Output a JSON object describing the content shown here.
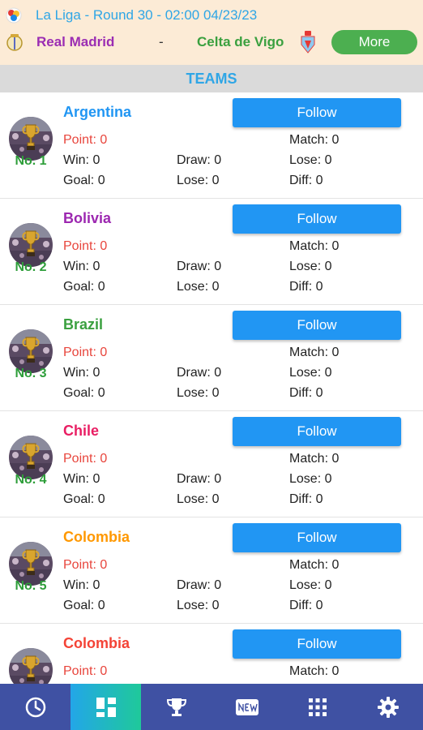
{
  "match": {
    "round_text": "La Liga - Round 30 - 02:00 04/23/23",
    "home_team": "Real Madrid",
    "separator": "-",
    "away_team": "Celta de Vigo",
    "more_label": "More"
  },
  "section_title": "TEAMS",
  "follow_label": "Follow",
  "teams": [
    {
      "name": "Argentina",
      "color": "#2196f3",
      "rank": "No. 1",
      "point": "Point: 0",
      "match": "Match: 0",
      "win": "Win: 0",
      "draw": "Draw: 0",
      "lose": "Lose: 0",
      "goal": "Goal: 0",
      "goal_lose": "Lose: 0",
      "diff": "Diff: 0"
    },
    {
      "name": "Bolivia",
      "color": "#9c27b0",
      "rank": "No. 2",
      "point": "Point: 0",
      "match": "Match: 0",
      "win": "Win: 0",
      "draw": "Draw: 0",
      "lose": "Lose: 0",
      "goal": "Goal: 0",
      "goal_lose": "Lose: 0",
      "diff": "Diff: 0"
    },
    {
      "name": "Brazil",
      "color": "#3aa03f",
      "rank": "No. 3",
      "point": "Point: 0",
      "match": "Match: 0",
      "win": "Win: 0",
      "draw": "Draw: 0",
      "lose": "Lose: 0",
      "goal": "Goal: 0",
      "goal_lose": "Lose: 0",
      "diff": "Diff: 0"
    },
    {
      "name": "Chile",
      "color": "#e91e63",
      "rank": "No. 4",
      "point": "Point: 0",
      "match": "Match: 0",
      "win": "Win: 0",
      "draw": "Draw: 0",
      "lose": "Lose: 0",
      "goal": "Goal: 0",
      "goal_lose": "Lose: 0",
      "diff": "Diff: 0"
    },
    {
      "name": "Colombia",
      "color": "#ff9800",
      "rank": "No. 5",
      "point": "Point: 0",
      "match": "Match: 0",
      "win": "Win: 0",
      "draw": "Draw: 0",
      "lose": "Lose: 0",
      "goal": "Goal: 0",
      "goal_lose": "Lose: 0",
      "diff": "Diff: 0"
    },
    {
      "name": "Colombia",
      "color": "#f44336",
      "rank": "",
      "point": "Point: 0",
      "match": "Match: 0",
      "win": "",
      "draw": "",
      "lose": "",
      "goal": "",
      "goal_lose": "",
      "diff": ""
    }
  ],
  "bottom_nav": [
    {
      "icon": "clock-icon",
      "active": false
    },
    {
      "icon": "dashboard-icon",
      "active": true
    },
    {
      "icon": "trophy-icon",
      "active": false
    },
    {
      "icon": "new-badge-icon",
      "active": false
    },
    {
      "icon": "apps-grid-icon",
      "active": false
    },
    {
      "icon": "gear-icon",
      "active": false
    }
  ]
}
